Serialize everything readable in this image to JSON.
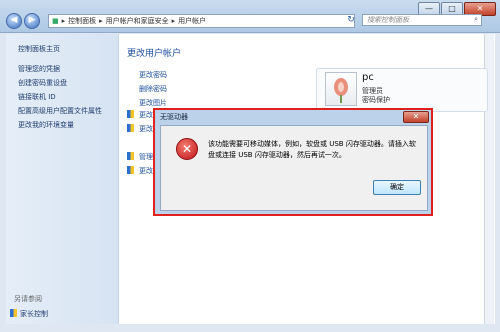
{
  "window": {
    "minimize": "—",
    "maximize": "□",
    "close": "✕"
  },
  "nav": {
    "back": "◀",
    "forward": "▶"
  },
  "breadcrumb": {
    "root_icon": "控制面板图标",
    "items": [
      "控制面板",
      "用户帐户和家庭安全",
      "用户帐户"
    ],
    "sep": "▸"
  },
  "search": {
    "placeholder": "搜索控制面板",
    "icon": "⌕"
  },
  "sidebar": {
    "items": [
      "控制面板主页",
      "管理您的凭据",
      "创建密码重设盘",
      "链接联机 ID",
      "配置高级用户配置文件属性",
      "更改我的环境变量"
    ],
    "see_also": "另请参阅",
    "family": "家长控制"
  },
  "main": {
    "title": "更改用户帐户",
    "links": [
      "更改密码",
      "删除密码",
      "更改图片",
      "更改",
      "更改",
      "管理",
      "更改"
    ]
  },
  "user": {
    "name": "pc",
    "role": "管理员",
    "password": "密码保护"
  },
  "dialog": {
    "title": "无驱动器",
    "close": "✕",
    "message": "该功能需要可移动媒体，例如，软盘或 USB 闪存驱动器。请插入软盘或连接 USB 闪存驱动器，然后再试一次。",
    "ok": "确定",
    "icon": "✕"
  },
  "colors": {
    "accent": "#1e4fa0",
    "highlight_border": "#e0201c"
  }
}
